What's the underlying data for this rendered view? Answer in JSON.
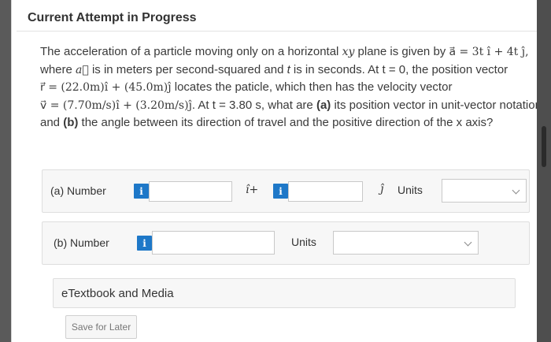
{
  "page": {
    "title": "Current Attempt in Progress"
  },
  "question": {
    "intro": "The acceleration of a particle moving only on a horizontal ",
    "xy": "xy",
    "plane_text": " plane is given by ",
    "accel_eq": "a⃗ = 3t î + 4t ĵ,",
    "where": "where ",
    "a_vec": "a⃗",
    "units_text": " is in meters per second-squared and ",
    "t": "t",
    "seconds_text": " is in seconds. At ",
    "t0": "t = 0",
    "position_text": ", the position vector",
    "r_eq": "r⃗ = (22.0m)î + (45.0m)ĵ",
    "locates_text": " locates the paticle, which then has the velocity vector",
    "v_eq": "v⃗ = (7.70m/s)î + (3.20m/s)ĵ",
    "at_text": ". At ",
    "t_value": "t = 3.80 s",
    "ask_text": ", what are ",
    "a_label": "(a)",
    "a_text": " its position vector in unit-vector notation and ",
    "b_label": "(b)",
    "b_text": " the angle between its direction of travel and the positive direction of the x axis?"
  },
  "part_a": {
    "label": "(a)   Number",
    "info_icon": "i",
    "i_hat_plus": "î+",
    "info_icon2": "i",
    "j_hat": "ĵ",
    "units_label": "Units",
    "x_value": "",
    "y_value": "",
    "units_value": ""
  },
  "part_b": {
    "label": "(b)   Number",
    "info_icon": "i",
    "number_value": "",
    "units_label": "Units",
    "units_value": ""
  },
  "etextbook": {
    "label": "eTextbook and Media"
  },
  "save_button": {
    "label": "Save for Later"
  },
  "colors": {
    "info_blue": "#1e78c8",
    "panel_bg": "#f7f7f7"
  },
  "icons": [
    "info-icon",
    "chevron-down-icon"
  ]
}
